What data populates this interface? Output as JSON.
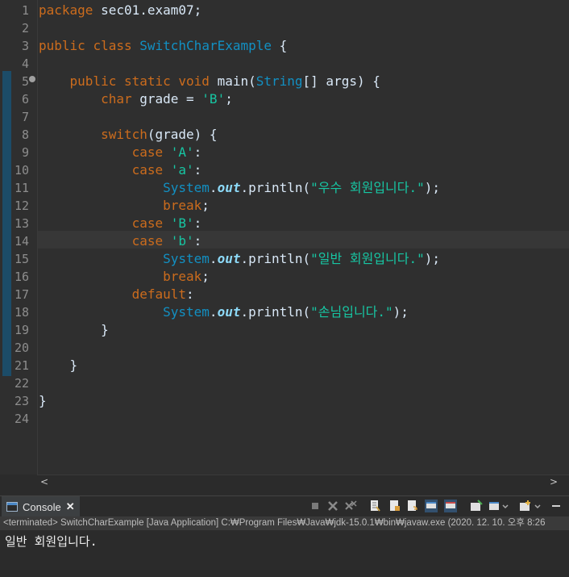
{
  "editor": {
    "line_numbers": [
      "1",
      "2",
      "3",
      "4",
      "5",
      "6",
      "7",
      "8",
      "9",
      "10",
      "11",
      "12",
      "13",
      "14",
      "15",
      "16",
      "17",
      "18",
      "19",
      "20",
      "21",
      "22",
      "23",
      "24"
    ],
    "current_line": "14",
    "code": {
      "l1_kw": "package",
      "l1_rest": " sec01.exam07;",
      "l3_kw1": "public",
      "l3_kw2": "class",
      "l3_cls": "SwitchCharExample",
      "l3_rest": " {",
      "l5_kw1": "public",
      "l5_kw2": "static",
      "l5_kw3": "void",
      "l5_name": " main(",
      "l5_ty": "String",
      "l5_rest": "[] args) {",
      "l6_kw": "char",
      "l6_a": " grade = ",
      "l6_str": "'B'",
      "l6_b": ";",
      "l8_kw": "switch",
      "l8_rest": "(grade) {",
      "l9_kw": "case",
      "l9_str": "'A'",
      "l9_b": ":",
      "l10_kw": "case",
      "l10_str": "'a'",
      "l10_b": ":",
      "l11_cls": "System",
      "l11_dot": ".",
      "l11_fld": "out",
      "l11_a": ".println(",
      "l11_str": "\"우수 회원입니다.\"",
      "l11_b": ");",
      "l12_kw": "break",
      "l12_b": ";",
      "l13_kw": "case",
      "l13_str": "'B'",
      "l13_b": ":",
      "l14_kw": "case",
      "l14_str": "'b'",
      "l14_b": ":",
      "l15_cls": "System",
      "l15_dot": ".",
      "l15_fld": "out",
      "l15_a": ".println(",
      "l15_str": "\"일반 회원입니다.\"",
      "l15_b": ");",
      "l16_kw": "break",
      "l16_b": ";",
      "l17_kw": "default",
      "l17_b": ":",
      "l18_cls": "System",
      "l18_dot": ".",
      "l18_fld": "out",
      "l18_a": ".println(",
      "l18_str": "\"손님입니다.\"",
      "l18_b": ");",
      "l19": "}",
      "l21": "}",
      "l23": "}"
    }
  },
  "scrollbar": {
    "left_arrow": "<",
    "right_arrow": ">"
  },
  "console": {
    "tab_label": "Console",
    "close_glyph": "✕",
    "description": "<terminated> SwitchCharExample [Java Application] C:₩Program Files₩Java₩jdk-15.0.1₩bin₩javaw.exe  (2020. 12. 10. 오후 8:26",
    "output_line": "일반 회원입니다."
  },
  "colors": {
    "keyword": "#cc6c1d",
    "type": "#1290c3",
    "string": "#17c6a3",
    "field": "#8ddaf8",
    "text": "#d9e8f7",
    "background": "#2f2f2f"
  },
  "icons": [
    "console-icon",
    "terminate-icon",
    "remove-launch-icon",
    "remove-all-terminated-icon",
    "clear-console-icon",
    "scroll-lock-icon",
    "word-wrap-icon",
    "show-on-stdout-icon",
    "show-on-stderr-icon",
    "pin-console-icon",
    "display-selected-console-icon",
    "open-console-icon",
    "view-menu-icon",
    "minimize-icon"
  ]
}
